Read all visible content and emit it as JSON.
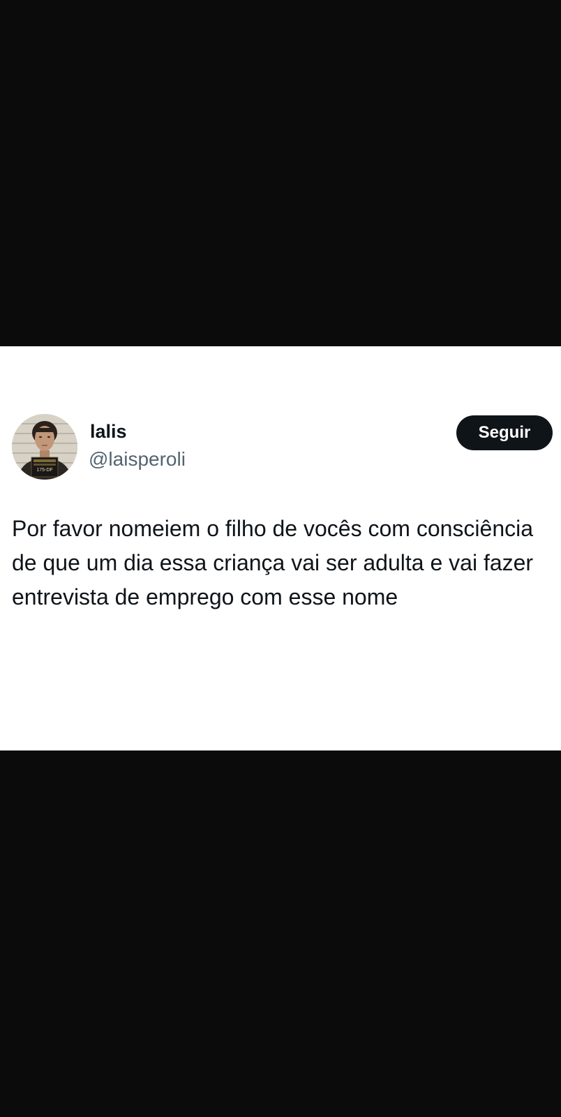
{
  "tweet": {
    "display_name": "lalis",
    "handle": "@laisperoli",
    "follow_label": "Seguir",
    "text": "Por favor nomeiem o filho de vocês com consciência de que um dia essa criança vai ser adulta e vai fazer entrevista de emprego com esse nome",
    "avatar_placard_text": "175-DF"
  },
  "colors": {
    "background": "#0b0b0b",
    "card": "#ffffff",
    "name_text": "#0f1419",
    "handle_text": "#536471",
    "button_bg": "#0f1419",
    "button_text": "#ffffff"
  },
  "icons": {
    "avatar": "avatar-mugshot-photo"
  }
}
